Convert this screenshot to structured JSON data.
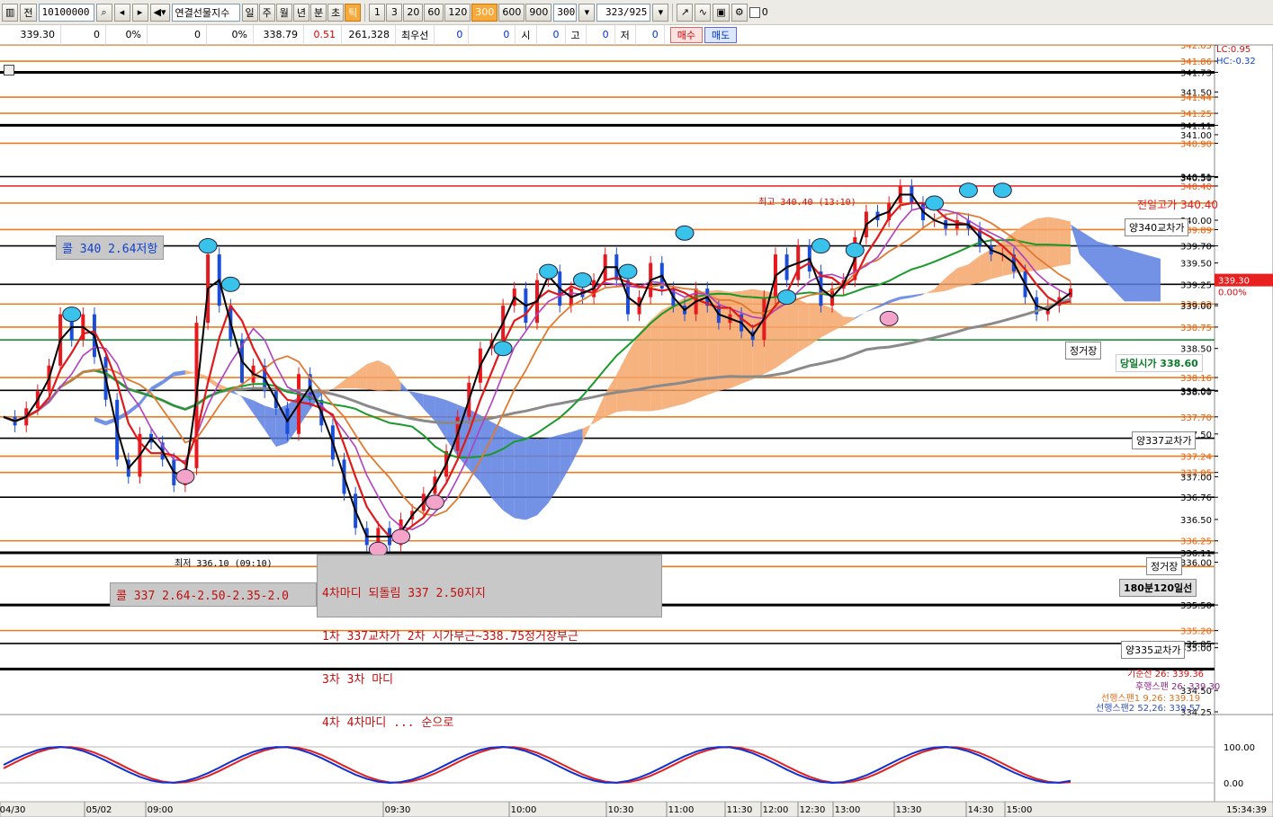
{
  "toolbar": {
    "code_prefix": "전",
    "code": "10100000",
    "instrument": "연결선물지수",
    "periods": [
      "일",
      "주",
      "월",
      "년",
      "분",
      "초",
      "틱"
    ],
    "active_period": "틱",
    "intervals": [
      "1",
      "3",
      "20",
      "60",
      "120",
      "300",
      "600",
      "900"
    ],
    "active_interval": "300",
    "interval_input": "300",
    "page_counter": "323/925",
    "checkbox_label": "0"
  },
  "quote": {
    "price": "339.30",
    "v1": "0",
    "v1pct": "0%",
    "v2": "0",
    "v2pct": "0%",
    "last": "338.79",
    "chg": "0.51",
    "volume": "261,328",
    "best_label": "최우선",
    "b1": "0",
    "b2": "0",
    "open_label": "시",
    "open": "0",
    "high_label": "고",
    "high": "0",
    "low_label": "저",
    "low": "0",
    "buy_label": "매수",
    "sell_label": "매도"
  },
  "colors": {
    "orange_line": "#f07b1e",
    "black_line": "#000000",
    "red_line": "#e83030",
    "green_line": "#1a8f3a",
    "cloud_orange": "#f4a468",
    "cloud_blue": "#5b7fe0",
    "bull": "#e8191e",
    "bear": "#1b4ed8"
  },
  "price_axis": {
    "min": 334.25,
    "max": 342.05,
    "ticks": [
      "342.05",
      "341.86",
      "341.73",
      "341.50",
      "341.44",
      "341.25",
      "341.11",
      "341.00",
      "340.90",
      "340.51",
      "340.40",
      "340.50",
      "339.89",
      "340.00",
      "339.70",
      "339.50",
      "339.25",
      "339.02",
      "339.00",
      "338.75",
      "338.50",
      "338.16",
      "338.01",
      "338.00",
      "337.70",
      "337.50",
      "337.24",
      "337.05",
      "337.00",
      "336.76",
      "336.50",
      "336.25",
      "336.11",
      "336.00",
      "335.50",
      "335.20",
      "335.05",
      "335.00",
      "334.50",
      "334.25"
    ],
    "current_price": "339.30",
    "pct_label": "0.00%",
    "lc_label": "LC:0.95",
    "hc_label": "HC:-0.32"
  },
  "horizontal_levels": [
    {
      "v": 342.05,
      "c": "orange"
    },
    {
      "v": 341.86,
      "c": "orange"
    },
    {
      "v": 341.73,
      "c": "black",
      "w": 3
    },
    {
      "v": 341.44,
      "c": "orange"
    },
    {
      "v": 341.25,
      "c": "orange"
    },
    {
      "v": 341.11,
      "c": "black",
      "w": 3
    },
    {
      "v": 340.9,
      "c": "orange"
    },
    {
      "v": 340.51,
      "c": "black"
    },
    {
      "v": 340.4,
      "c": "red"
    },
    {
      "v": 340.2,
      "c": "orange"
    },
    {
      "v": 339.89,
      "c": "orange"
    },
    {
      "v": 339.7,
      "c": "black"
    },
    {
      "v": 339.25,
      "c": "black"
    },
    {
      "v": 339.02,
      "c": "orange"
    },
    {
      "v": 338.75,
      "c": "orange"
    },
    {
      "v": 338.6,
      "c": "green"
    },
    {
      "v": 338.16,
      "c": "orange"
    },
    {
      "v": 338.01,
      "c": "black"
    },
    {
      "v": 337.7,
      "c": "orange"
    },
    {
      "v": 337.45,
      "c": "black"
    },
    {
      "v": 337.24,
      "c": "orange"
    },
    {
      "v": 337.05,
      "c": "orange"
    },
    {
      "v": 336.76,
      "c": "black"
    },
    {
      "v": 336.25,
      "c": "orange"
    },
    {
      "v": 336.11,
      "c": "black",
      "w": 3
    },
    {
      "v": 335.95,
      "c": "orange"
    },
    {
      "v": 335.5,
      "c": "black",
      "w": 3
    },
    {
      "v": 335.2,
      "c": "orange"
    },
    {
      "v": 335.05,
      "c": "black"
    },
    {
      "v": 334.75,
      "c": "black",
      "w": 3
    }
  ],
  "labels": {
    "call_340": "콜 340 2.64저항",
    "call_337": "콜 337 2.64-2.50-2.35-2.0",
    "note_lines": [
      "4차마디 되돌림 337 2.50지지",
      "1차 337교차가 2차 시가부근~338.75정거장부근",
      "3차 3차 마디",
      "4차 4차마디 ... 순으로"
    ],
    "high_note": "최고 340.40 (13:10)",
    "low_note": "최저 336.10 (09:10)",
    "prev_high": "전일고가 340.40",
    "yang340": "양340교차가",
    "station1": "정거장",
    "open_today": "당일시가 338.60",
    "yang337": "양337교차가",
    "station2": "정거장",
    "ma180": "180분120일선",
    "yang335": "양335교차가",
    "kijun": "기준선 26: 339.36",
    "lagging": "후행스팬 26: 339.30",
    "span1": "선행스팬1 9,26: 339.19",
    "span2": "선행스팬2 52,26: 339.57"
  },
  "osc_axis": {
    "ticks": [
      "100.00",
      "0.00"
    ]
  },
  "time_axis": {
    "labels": [
      "04/30",
      "05/02",
      "09:00",
      "09:30",
      "10:00",
      "10:30",
      "11:00",
      "11:30",
      "12:00",
      "12:30",
      "13:00",
      "13:30",
      "14:30",
      "15:00"
    ],
    "clock": "15:34:39"
  },
  "series": {
    "close": [
      337.7,
      337.6,
      337.8,
      338.0,
      338.3,
      338.9,
      338.6,
      338.9,
      338.4,
      337.9,
      337.2,
      337.0,
      337.5,
      337.4,
      337.2,
      336.9,
      337.1,
      338.8,
      339.6,
      339.0,
      338.6,
      338.1,
      338.3,
      338.0,
      337.8,
      337.5,
      338.2,
      337.9,
      337.6,
      337.2,
      336.8,
      336.4,
      336.2,
      336.4,
      336.2,
      336.5,
      336.6,
      336.8,
      337.0,
      337.3,
      337.7,
      338.1,
      338.5,
      338.6,
      339.0,
      339.2,
      338.8,
      339.3,
      339.4,
      339.0,
      339.2,
      339.1,
      339.3,
      339.6,
      339.3,
      338.9,
      339.1,
      339.5,
      339.2,
      339.0,
      338.9,
      339.2,
      339.0,
      338.8,
      338.9,
      338.7,
      338.6,
      339.1,
      339.6,
      339.3,
      339.7,
      339.4,
      339.0,
      339.2,
      339.3,
      339.8,
      340.1,
      340.0,
      340.2,
      340.4,
      340.2,
      340.0,
      340.0,
      339.9,
      340.0,
      339.9,
      339.7,
      339.6,
      339.6,
      339.4,
      339.1,
      338.9,
      339.0,
      339.1,
      339.2
    ]
  }
}
